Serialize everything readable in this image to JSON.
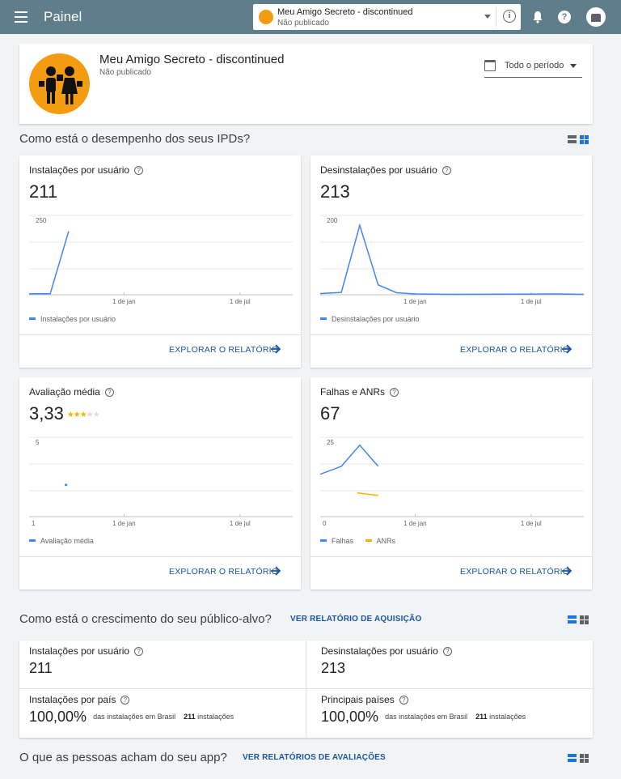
{
  "topbar": {
    "title": "Painel",
    "app_selector": {
      "name": "Meu Amigo Secreto - discontinued",
      "status": "Não publicado"
    }
  },
  "app_header": {
    "name": "Meu Amigo Secreto - discontinued",
    "status": "Não publicado",
    "period": "Todo o período"
  },
  "sections": {
    "performance": {
      "title": "Como está o desempenho dos seus IPDs?"
    },
    "growth": {
      "title": "Como está o crescimento do seu público-alvo?",
      "link": "VER RELATÓRIO DE AQUISIÇÃO"
    },
    "opinions": {
      "title": "O que as pessoas acham do seu app?",
      "link": "VER RELATÓRIOS DE AVALIAÇÕES"
    }
  },
  "explore_label": "EXPLORAR O RELATÓRIO",
  "cards": {
    "installs": {
      "title": "Instalações por usuário",
      "value": "211",
      "legend": "Instalações por usuário"
    },
    "uninstalls": {
      "title": "Desinstalações por usuário",
      "value": "213",
      "legend": "Desinstalações por usuário"
    },
    "rating": {
      "title": "Avaliação média",
      "value": "3,33",
      "stars": 3,
      "legend": "Avaliação média"
    },
    "crashes": {
      "title": "Falhas e ANRs",
      "value": "67",
      "legend_crashes": "Falhas",
      "legend_anrs": "ANRs"
    }
  },
  "growth": {
    "installs": {
      "title": "Instalações por usuário",
      "value": "211"
    },
    "uninstalls": {
      "title": "Desinstalações por usuário",
      "value": "213"
    },
    "by_country": {
      "title": "Instalações por país",
      "value": "100,00%",
      "sub": "das instalações em Brasil",
      "count": "211",
      "count_label": "instalações"
    },
    "top_countries": {
      "title": "Principais países",
      "value": "100,00%",
      "sub": "das instalações em Brasil",
      "count": "211",
      "count_label": "instalações"
    }
  },
  "colors": {
    "topbar": "#5f7d8b",
    "series_blue": "#4285f4",
    "series_yellow": "#f4b400",
    "link": "#1a56a0"
  },
  "chart_data": [
    {
      "type": "line",
      "name": "installs",
      "ymax_label": "250",
      "ylim": [
        0,
        250
      ],
      "xlim": [
        0,
        1
      ],
      "x_ticks": [
        {
          "label": "1 de jan",
          "x": 0.36
        },
        {
          "label": "1 de jul",
          "x": 0.8
        }
      ],
      "series": [
        {
          "name": "Instalações por usuário",
          "color": "#4285f4",
          "points": [
            [
              0.0,
              3
            ],
            [
              0.08,
              3
            ],
            [
              0.15,
              200
            ]
          ]
        }
      ]
    },
    {
      "type": "line",
      "name": "uninstalls",
      "ymax_label": "200",
      "ylim": [
        0,
        200
      ],
      "xlim": [
        0,
        1
      ],
      "x_ticks": [
        {
          "label": "1 de jan",
          "x": 0.36
        },
        {
          "label": "1 de jul",
          "x": 0.8
        }
      ],
      "series": [
        {
          "name": "Desinstalações por usuário",
          "color": "#4285f4",
          "points": [
            [
              0.0,
              3
            ],
            [
              0.08,
              6
            ],
            [
              0.15,
              175
            ],
            [
              0.22,
              25
            ],
            [
              0.29,
              5
            ],
            [
              0.36,
              2
            ],
            [
              0.5,
              1
            ],
            [
              0.9,
              2
            ],
            [
              1.0,
              1
            ]
          ]
        }
      ]
    },
    {
      "type": "line",
      "name": "rating",
      "ymax_label": "5",
      "ymin_label": "1",
      "ylim": [
        1,
        5
      ],
      "xlim": [
        0,
        1
      ],
      "x_ticks": [
        {
          "label": "1 de jan",
          "x": 0.36
        },
        {
          "label": "1 de jul",
          "x": 0.8
        }
      ],
      "series": [
        {
          "name": "Avaliação média",
          "color": "#4285f4",
          "points": [
            [
              0.14,
              2.6
            ]
          ]
        }
      ]
    },
    {
      "type": "line",
      "name": "crashes",
      "ymax_label": "25",
      "ymin_label": "0",
      "ylim": [
        0,
        30
      ],
      "xlim": [
        0,
        1
      ],
      "x_ticks": [
        {
          "label": "1 de jan",
          "x": 0.36
        },
        {
          "label": "1 de jul",
          "x": 0.8
        }
      ],
      "series": [
        {
          "name": "Falhas",
          "color": "#4285f4",
          "points": [
            [
              0.0,
              16
            ],
            [
              0.08,
              19
            ],
            [
              0.15,
              27
            ],
            [
              0.22,
              19
            ]
          ]
        },
        {
          "name": "ANRs",
          "color": "#f4b400",
          "points": [
            [
              0.14,
              9
            ],
            [
              0.22,
              8
            ]
          ]
        }
      ]
    }
  ]
}
